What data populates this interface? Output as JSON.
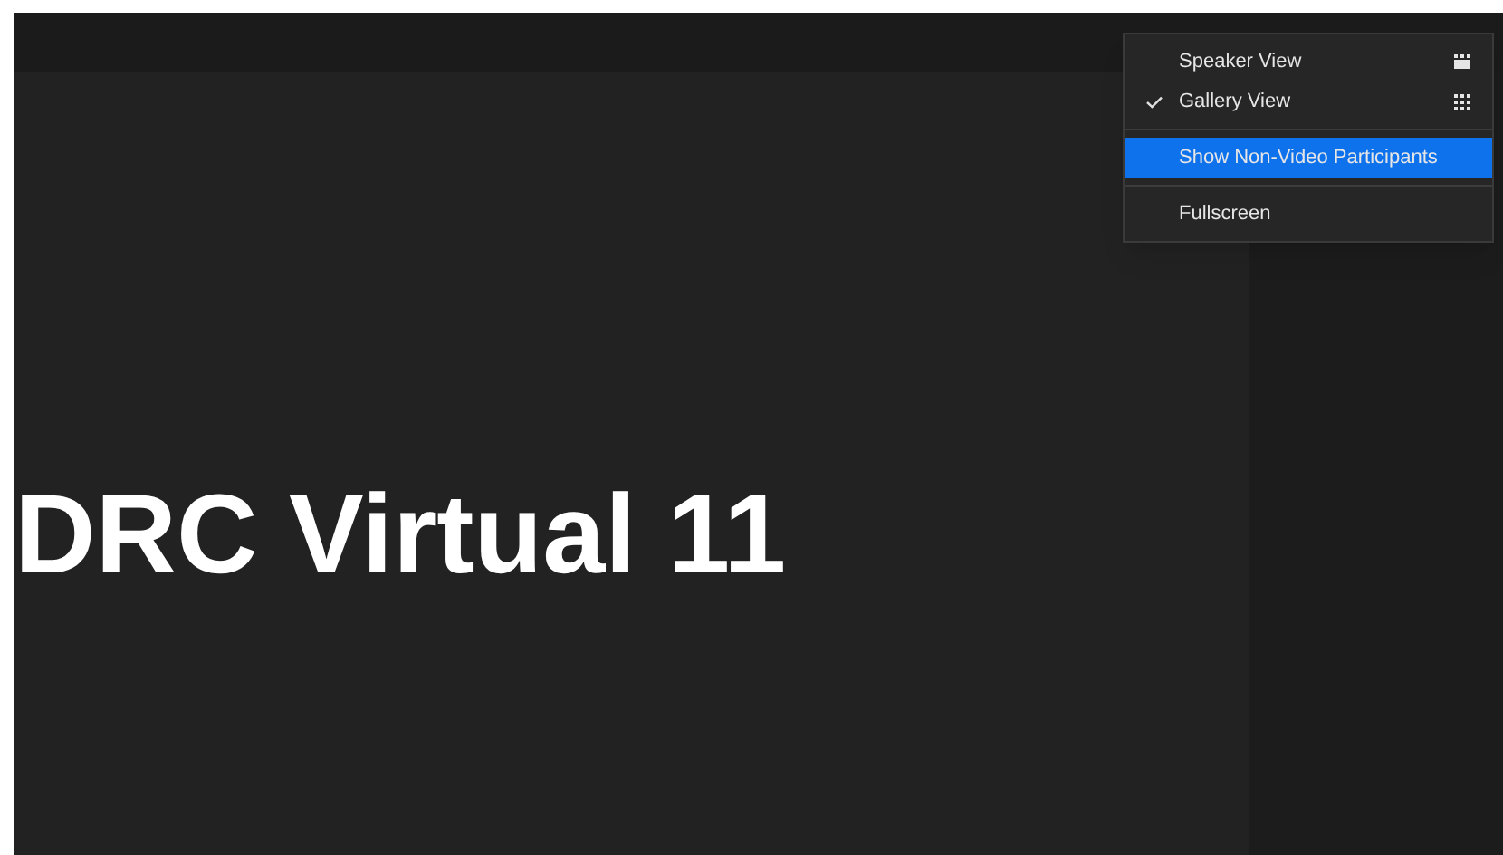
{
  "slide": {
    "title": "DRC Virtual 11"
  },
  "menu": {
    "groups": [
      [
        {
          "label": "Speaker View",
          "kind": "speaker",
          "checked": false,
          "selected": false
        },
        {
          "label": "Gallery View",
          "kind": "gallery",
          "checked": true,
          "selected": false
        }
      ],
      [
        {
          "label": "Show Non-Video Participants",
          "kind": "plain",
          "checked": false,
          "selected": true
        }
      ],
      [
        {
          "label": "Fullscreen",
          "kind": "plain",
          "checked": false,
          "selected": false
        }
      ]
    ]
  }
}
